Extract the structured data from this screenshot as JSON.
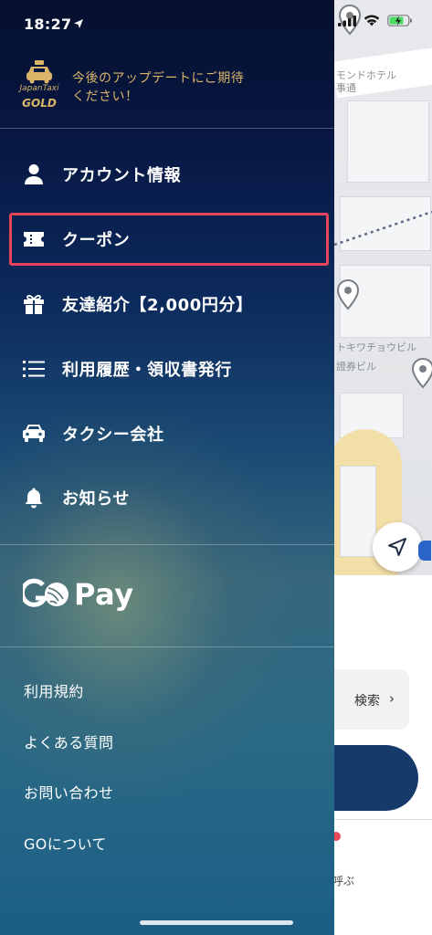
{
  "status_bar": {
    "time": "18:27"
  },
  "header": {
    "logo_line1": "JapanTaxi",
    "logo_line2": "GOLD",
    "message_line1": "今後のアップデートにご期待",
    "message_line2": "ください！",
    "accent_color": "#d9b56a"
  },
  "menu": {
    "items": [
      {
        "label": "アカウント情報",
        "icon": "person-icon"
      },
      {
        "label": "クーポン",
        "icon": "ticket-icon",
        "selected": true
      },
      {
        "label": "友達紹介【2,000円分】",
        "icon": "gift-icon"
      },
      {
        "label": "利用履歴・領収書発行",
        "icon": "list-icon"
      },
      {
        "label": "タクシー会社",
        "icon": "taxi-car-icon"
      },
      {
        "label": "お知らせ",
        "icon": "bell-icon"
      }
    ],
    "highlight_color": "#e8445a"
  },
  "gopay": {
    "brand_go": "GO",
    "brand_pay": "Pay"
  },
  "footer": {
    "links": [
      "利用規約",
      "よくある質問",
      "お問い合わせ",
      "GOについて"
    ]
  },
  "map": {
    "labels": [
      "モンドホテル",
      "事通",
      "トキワチョウビル",
      "證券ビル"
    ],
    "search_label": "検索",
    "bottom_text": "呼ぶ"
  }
}
